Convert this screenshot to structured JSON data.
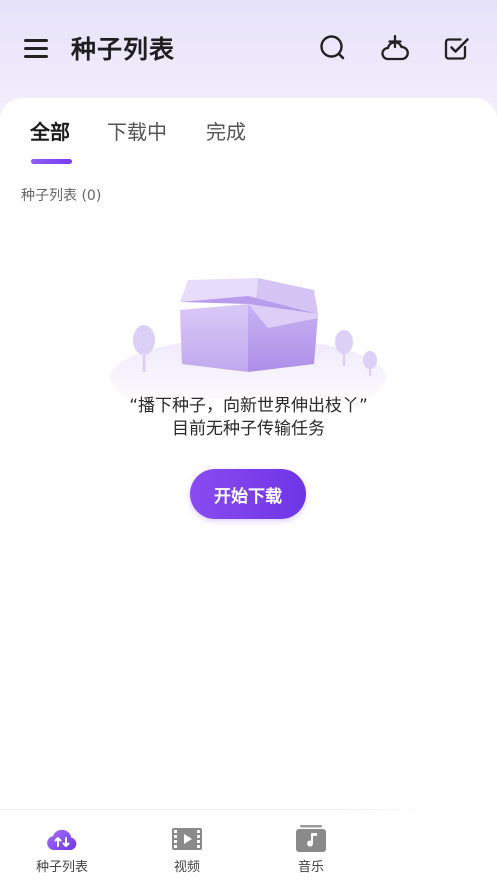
{
  "header": {
    "title": "种子列表",
    "icons": [
      "menu-icon",
      "search-icon",
      "cloud-add-icon",
      "checkbox-icon"
    ]
  },
  "tabs": [
    {
      "label": "全部",
      "active": true
    },
    {
      "label": "下载中",
      "active": false
    },
    {
      "label": "完成",
      "active": false
    }
  ],
  "list": {
    "count_label": "种子列表 (0)"
  },
  "empty_state": {
    "line1": "“播下种子，向新世界伸出枝丫”",
    "line2": "目前无种子传输任务",
    "button_label": "开始下载"
  },
  "bottom_nav": [
    {
      "label": "种子列表",
      "icon": "seed-cloud-icon",
      "active": true
    },
    {
      "label": "视频",
      "icon": "video-icon",
      "active": false
    },
    {
      "label": "音乐",
      "icon": "music-icon",
      "active": false
    }
  ],
  "colors": {
    "accent": "#7c3aed",
    "header_bg": "#ebe6fa",
    "illustration": "#c9b6f2"
  }
}
